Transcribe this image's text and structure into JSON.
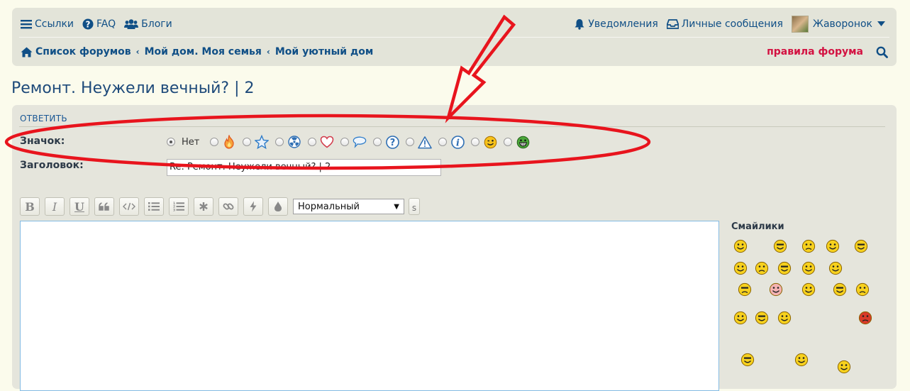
{
  "navbar": {
    "links": {
      "label": "Ссылки"
    },
    "faq": {
      "label": "FAQ"
    },
    "blogs": {
      "label": "Блоги"
    },
    "notifications": {
      "label": "Уведомления"
    },
    "messages": {
      "label": "Личные сообщения"
    },
    "user": {
      "label": "Жаворонок"
    },
    "breadcrumbs": [
      "Список форумов",
      "Мой дом. Моя семья",
      "Мой уютный дом"
    ],
    "rules": "правила форума"
  },
  "topic": {
    "title": "Ремонт. Неужели вечный? | 2"
  },
  "reply": {
    "heading": "ОТВЕТИТЬ",
    "icon_label": "Значок:",
    "icon_none": "Нет",
    "icon_options": [
      "fire-icon",
      "star-icon",
      "radioactive-icon",
      "heart-icon",
      "speech-bubble-icon",
      "question-icon",
      "warning-icon",
      "info-icon",
      "wink-smiley-icon",
      "grin-smiley-icon"
    ],
    "subject_label": "Заголовок:",
    "subject_value": "Re: Ремонт. Неужели вечный? | 2"
  },
  "toolbar": {
    "bold": "B",
    "italic": "I",
    "underline": "U",
    "font_size": "Нормальный",
    "extra": "s"
  },
  "smilies": {
    "title": "Смайлики"
  },
  "colors": {
    "accent": "#104f86",
    "rules": "#d31141",
    "annotation": "#e8141d"
  }
}
